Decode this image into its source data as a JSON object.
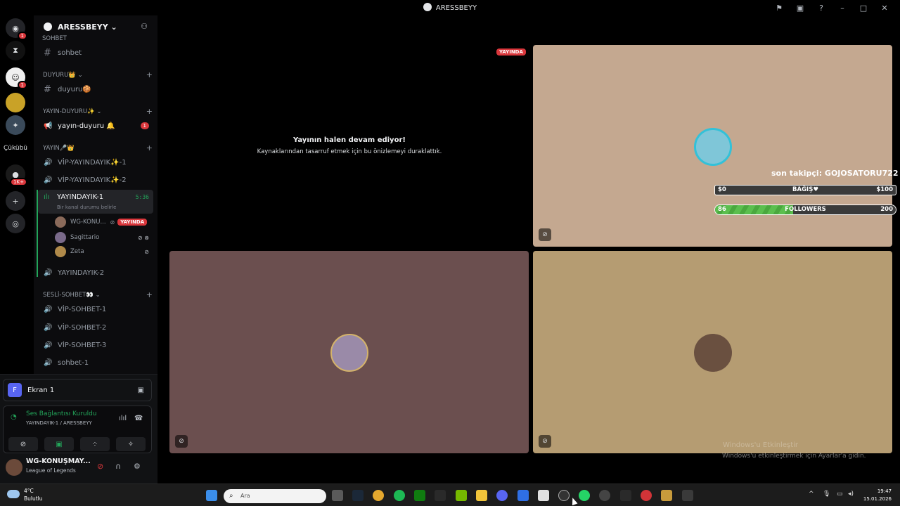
{
  "window": {
    "title": "ARESSBEYY",
    "title_icons": [
      "flag-icon",
      "inbox-icon",
      "help-icon"
    ],
    "controls": [
      "minimize-icon",
      "maximize-icon",
      "close-icon"
    ]
  },
  "rail": {
    "items": [
      {
        "name": "discord-home-icon",
        "badge": "1"
      },
      {
        "name": "server-hourglass",
        "badge": ""
      },
      {
        "name": "server-avatar-1",
        "badge": "1"
      },
      {
        "name": "server-avatar-2",
        "badge": ""
      },
      {
        "name": "server-avatar-3",
        "badge": ""
      }
    ],
    "text_server": "Çükübü",
    "server_badge_1k": "1K+"
  },
  "guild": {
    "name": "ARESSBEYY"
  },
  "channels": {
    "partial_category": "SOHBET",
    "sohbet": "sohbet",
    "cat_duyuru": "DUYURU👑",
    "duyuru": "duyuru🍪",
    "cat_yayin_duyuru": "YAYIN-DUYURU✨",
    "yayin_duyuru": "yayın-duyuru 🔔",
    "yayin_duyuru_badge": "1",
    "cat_yayin": "YAYIN🎤👑",
    "vip1": "VİP-YAYINDAYIK✨-1",
    "vip2": "VİP-YAYINDAYIK✨-2",
    "active_name": "YAYINDAYIK-1",
    "active_time": "5:36",
    "active_status": "Bir kanal durumu belirle",
    "voice_users": [
      {
        "name": "WG-KONU...",
        "live": "YAYINDA",
        "color": "#8a6a5a"
      },
      {
        "name": "Sagittario",
        "live": "",
        "color": "#7a6a8a"
      },
      {
        "name": "Zeta",
        "live": "",
        "color": "#b08a4a"
      }
    ],
    "yayindayik2": "YAYINDAYIK-2",
    "cat_sesli": "SESLİ-SOHBET👀",
    "vip_sohbet1": "VİP-SOHBET-1",
    "vip_sohbet2": "VİP-SOHBET-2",
    "vip_sohbet3": "VİP-SOHBET-3",
    "sohbet1": "sohbet-1"
  },
  "panel": {
    "screen_letter": "F",
    "screen_label": "Ekran 1",
    "voice_connected": "Ses Bağlantısı Kuruldu",
    "voice_location": "YAYINDAYIK-1 / ARESSBEYY",
    "username": "WG-KONUŞMAY...",
    "user_status": "League of Legends"
  },
  "stage": {
    "live_badge": "YAYINDA",
    "paused_title": "Yayının halen devam ediyor!",
    "paused_sub": "Kaynaklarından tasarruf etmek için bu önizlemeyi duraklattık.",
    "tile_colors": [
      "#c4a890",
      "#6b4f4f",
      "#b59c72"
    ],
    "overlay_follower": "son takipçi: GOJOSATORU722",
    "donation_bar": {
      "min": "$0",
      "label": "BAĞIŞ♥",
      "max": "$100"
    },
    "followers_bar": {
      "current": "86",
      "label": "FOLLOWERS",
      "goal": "200",
      "progress": 0.43
    },
    "watermark_title": "Windows'u Etkinleştir",
    "watermark_sub": "Windows'u etkinleştirmek için Ayarlar'a gidin."
  },
  "taskbar": {
    "temp": "4°C",
    "weather": "Bulutlu",
    "search_placeholder": "Ara",
    "time": "19:47",
    "date": "15.01.2026"
  }
}
